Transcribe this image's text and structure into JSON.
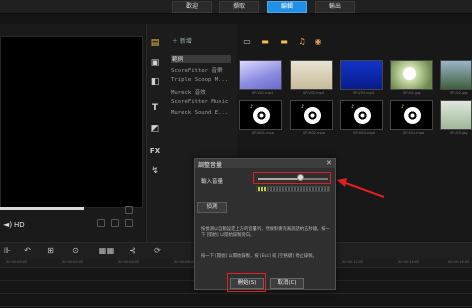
{
  "header": {
    "tabs": [
      {
        "label": "歡迎",
        "active": false
      },
      {
        "label": "擷取",
        "active": false
      },
      {
        "label": "編輯",
        "active": true
      },
      {
        "label": "輸出",
        "active": false
      }
    ]
  },
  "preview": {
    "hd_label": "HD"
  },
  "library": {
    "add_label": "新增",
    "items": [
      "範例",
      "ScoreFitter 音樂",
      "Triple Scoop M...",
      "Mureck 音效",
      "ScoreFitter Music",
      "Mureck Sound E..."
    ]
  },
  "thumbnails": {
    "captions": [
      "SP-V01.mp4",
      "SP-V02.mp4",
      "SP-V03.mp4",
      "SP-I01.jpg",
      "SP-I02.jpg",
      "SP-M01.mpa",
      "SP-M02.mpa",
      "SP-M03.mpa",
      "SP-S01.mpa",
      "SP-I03.jpg"
    ]
  },
  "timeline": {
    "ruler_labels": [
      "00:00:00:00",
      "00:00:02:00",
      "00:00:04:00",
      "00:00:06:00",
      "00:00:08:00",
      "00:00:10:00",
      "00:00:12:00",
      "00:00:14:00",
      "00:00:16:00"
    ]
  },
  "dialog": {
    "title": "調整音量",
    "close": "✕",
    "input_volume_label": "輸入音量",
    "volume_level": 0.6,
    "detect_button": "偵測",
    "instruction_1": "按偵測以自動設定上方的音量列，然後對麥克風說話約五秒鐘。按一下 [開始] 以開始錄製旁白。",
    "instruction_2": "按一下 [開始] 以開始錄製，按 [Esc] 或 [空格鍵] 停止錄製。",
    "start_button": "開始(S)",
    "cancel_button": "取消(C)"
  },
  "colors": {
    "active_tab": "#1e90e6",
    "highlight": "#e02020"
  },
  "icons": [
    "folder-icon",
    "video-icon",
    "image-icon",
    "music-icon",
    "effect-icon",
    "text-icon",
    "transition-icon",
    "fx-icon",
    "path-icon"
  ]
}
